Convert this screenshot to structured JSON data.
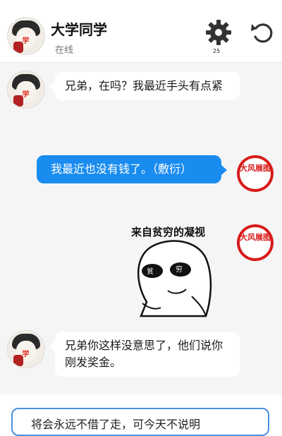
{
  "header": {
    "title": "大学同学",
    "status": "在线",
    "settings_badge": "25",
    "contact_avatar_text": "学"
  },
  "messages": [
    {
      "side": "left",
      "text": "兄弟，在吗？我最近手头有点紧"
    },
    {
      "side": "right",
      "text": "我最近也没有钱了。（敷衍）"
    },
    {
      "side": "right",
      "type": "sticker",
      "caption": "来自贫穷的凝视",
      "eye_left": "贫",
      "eye_right": "穷"
    },
    {
      "side": "left",
      "text": "兄弟你这样没意思了，他们说你刚发奖金。"
    }
  ],
  "self_avatar_text": "大风展图",
  "input": {
    "text": "将会永远不借了走，可今天不说明"
  },
  "colors": {
    "accent": "#1a8cf0",
    "seal_red": "#d81a1a",
    "input_border": "#4a90e2"
  }
}
